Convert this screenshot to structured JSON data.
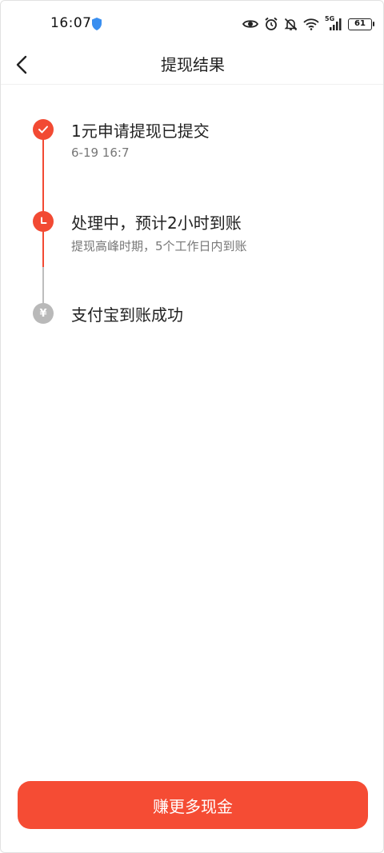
{
  "status_bar": {
    "time": "16:07",
    "battery": "61",
    "network_label": "5G"
  },
  "header": {
    "title": "提现结果"
  },
  "timeline": {
    "steps": [
      {
        "title": "1元申请提现已提交",
        "subtitle": "6-19 16:7",
        "state": "done",
        "icon": "check-icon"
      },
      {
        "title": "处理中，预计2小时到账",
        "subtitle": "提现高峰时期，5个工作日内到账",
        "state": "current",
        "icon": "clock-icon"
      },
      {
        "title": "支付宝到账成功",
        "subtitle": "",
        "state": "pending",
        "icon": "yen-icon",
        "glyph": "¥"
      }
    ]
  },
  "actions": {
    "earn_more_label": "赚更多现金"
  },
  "colors": {
    "accent": "#f24a33",
    "pending": "#b9b9b9",
    "button": "#f54c34"
  }
}
